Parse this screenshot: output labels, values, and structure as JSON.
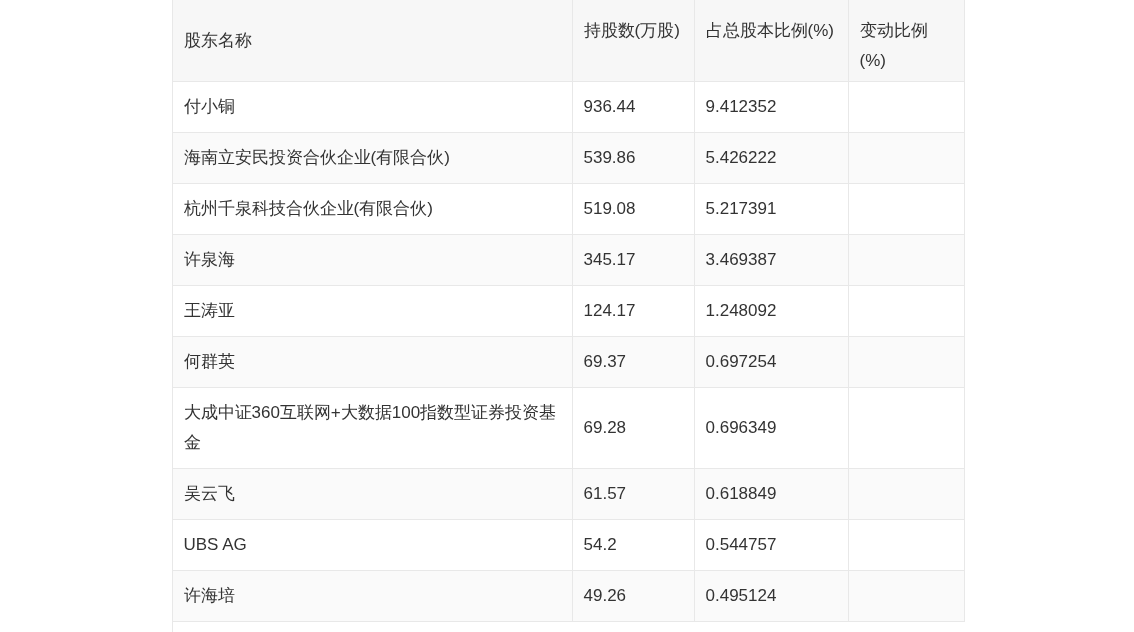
{
  "table": {
    "columns": [
      "股东名称",
      "持股数(万股)",
      "占总股本比例(%)",
      "变动比例(%)"
    ],
    "rows": [
      {
        "name": "付小铜",
        "shares": "936.44",
        "ratio": "9.412352"
      },
      {
        "name": "海南立安民投资合伙企业(有限合伙)",
        "shares": "539.86",
        "ratio": "5.426222"
      },
      {
        "name": "杭州千泉科技合伙企业(有限合伙)",
        "shares": "519.08",
        "ratio": "5.217391"
      },
      {
        "name": "许泉海",
        "shares": "345.17",
        "ratio": "3.469387"
      },
      {
        "name": "王涛亚",
        "shares": "124.17",
        "ratio": "1.248092"
      },
      {
        "name": "何群英",
        "shares": "69.37",
        "ratio": "0.697254"
      },
      {
        "name": "大成中证360互联网+大数据100指数型证券投资基金",
        "shares": "69.28",
        "ratio": "0.696349"
      },
      {
        "name": "吴云飞",
        "shares": "61.57",
        "ratio": "0.618849"
      },
      {
        "name": "UBS AG",
        "shares": "54.2",
        "ratio": "0.544757"
      },
      {
        "name": "许海培",
        "shares": "49.26",
        "ratio": "0.495124"
      }
    ]
  }
}
